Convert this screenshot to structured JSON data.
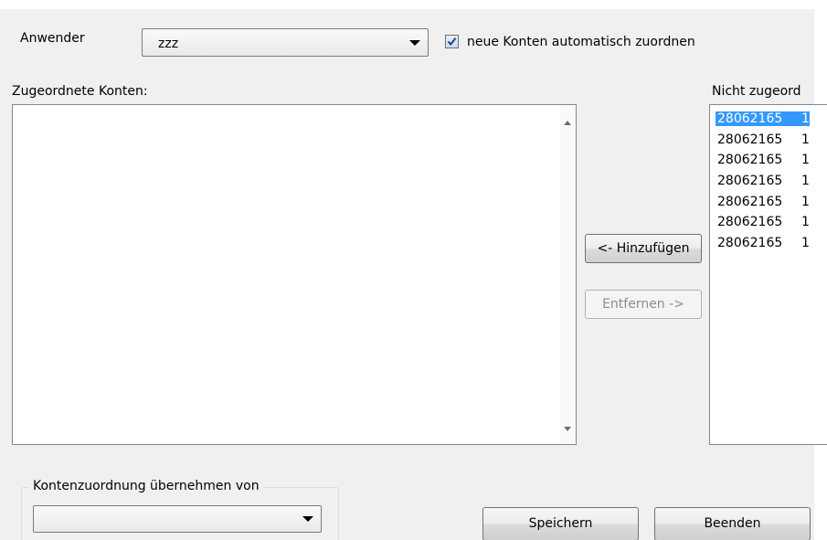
{
  "user": {
    "label": "Anwender",
    "combo_value": "zzz"
  },
  "auto_assign": {
    "checked": true,
    "label": "neue Konten automatisch zuordnen"
  },
  "assigned": {
    "label": "Zugeordnete Konten:",
    "items": []
  },
  "unassigned": {
    "label": "Nicht zugeord",
    "items": [
      {
        "number": "28062165",
        "suffix": "1",
        "selected": true
      },
      {
        "number": "28062165",
        "suffix": "1",
        "selected": false
      },
      {
        "number": "28062165",
        "suffix": "1",
        "selected": false
      },
      {
        "number": "28062165",
        "suffix": "1",
        "selected": false
      },
      {
        "number": "28062165",
        "suffix": "1",
        "selected": false
      },
      {
        "number": "28062165",
        "suffix": "1",
        "selected": false
      },
      {
        "number": "28062165",
        "suffix": "1",
        "selected": false
      }
    ]
  },
  "buttons": {
    "add": "<- Hinzufügen",
    "remove": "Entfernen ->",
    "save": "Speichern",
    "close": "Beenden"
  },
  "copy_from": {
    "group_title": "Kontenzuordnung übernehmen von",
    "combo_value": ""
  },
  "colors": {
    "dialog_bg": "#f0f0f0",
    "selection": "#3399ff",
    "check_mark": "#1f3c88"
  },
  "icons": {
    "combo_arrow": "chevron-down-icon",
    "checkbox_mark": "checkmark-icon",
    "scroll_up": "scroll-up-icon",
    "scroll_down": "scroll-down-icon"
  }
}
